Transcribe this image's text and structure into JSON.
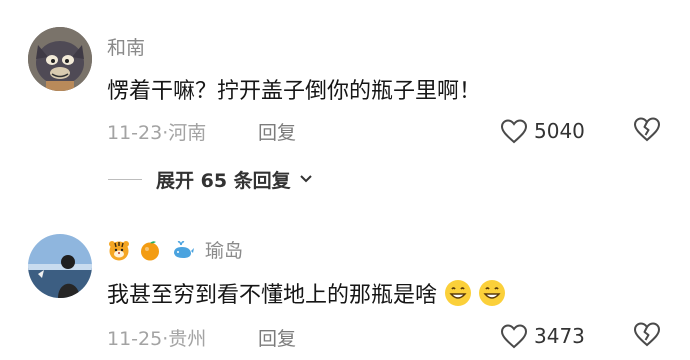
{
  "comments": [
    {
      "username": "和南",
      "text": "愣着干嘛？拧开盖子倒你的瓶子里啊！",
      "date": "11-23",
      "location": "河南",
      "reply_label": "回复",
      "likes": "5040",
      "avatar_icon": "cartoon-cat-avatar"
    },
    {
      "username": "瑜岛",
      "badges": [
        "tiger-emoji",
        "orange-emoji",
        "whale-emoji"
      ],
      "text": "我甚至穷到看不懂地上的那瓶是啥",
      "trailing_emojis": [
        "grinning-face-emoji",
        "grinning-face-emoji"
      ],
      "date": "11-25",
      "location": "贵州",
      "reply_label": "回复",
      "likes": "3473",
      "avatar_icon": "person-photo-avatar"
    }
  ],
  "expand_replies": {
    "label": "展开 65 条回复"
  },
  "meta_separator": "·",
  "colors": {
    "text": "#161616",
    "secondary": "#8a8a8a",
    "meta": "#a3a3a3"
  }
}
